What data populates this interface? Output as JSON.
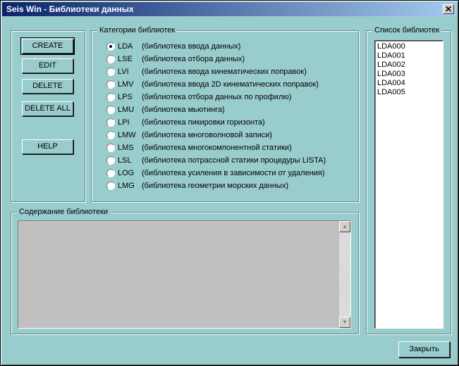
{
  "window": {
    "title": "Seis Win - Библиотеки данных",
    "close_glyph": "✕"
  },
  "actions": {
    "create": "CREATE",
    "edit": "EDIT",
    "delete": "DELETE",
    "delete_all": "DELETE ALL",
    "help": "HELP"
  },
  "categories": {
    "legend": "Категории библиотек",
    "selected": "LDA",
    "items": [
      {
        "code": "LDA",
        "desc": "(библиотека ввода данных)"
      },
      {
        "code": "LSE",
        "desc": "(библиотека отбора данных)"
      },
      {
        "code": "LVI",
        "desc": "(библиотека ввода кинематических поправок)"
      },
      {
        "code": "LMV",
        "desc": "(библиотека ввода 2D кинематических поправок)"
      },
      {
        "code": "LPS",
        "desc": "(библиотека отбора данных по профилю)"
      },
      {
        "code": "LMU",
        "desc": "(библиотека мьютинга)"
      },
      {
        "code": "LPI",
        "desc": "(библиотека пикировки горизонта)"
      },
      {
        "code": "LMW",
        "desc": "(библиотека многоволновой записи)"
      },
      {
        "code": "LMS",
        "desc": "(библиотека многокомпонентной статики)"
      },
      {
        "code": "LSL",
        "desc": "(библиотека потрассной статики процедуры LISTA)"
      },
      {
        "code": "LOG",
        "desc": "(библиотека усиления в зависимости от удаления)"
      },
      {
        "code": "LMG",
        "desc": "(библиотека геометрии морских данных)"
      }
    ]
  },
  "library_list": {
    "legend": "Список библиотек",
    "items": [
      "LDA000",
      "LDA001",
      "LDA002",
      "LDA003",
      "LDA004",
      "LDA005"
    ]
  },
  "contents": {
    "legend": "Содержание библиотеки"
  },
  "footer": {
    "close_label": "Закрыть"
  },
  "icons": {
    "scroll_up": "scroll-up-arrow-icon",
    "scroll_down": "scroll-down-arrow-icon"
  }
}
